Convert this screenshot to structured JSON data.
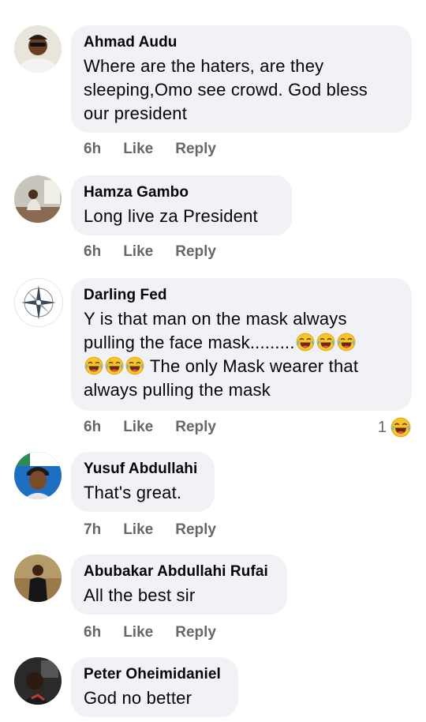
{
  "comments": [
    {
      "author": "Ahmad Audu",
      "lines": [
        "Where are the haters, are they",
        "sleeping,Omo see crowd. God bless",
        "our president"
      ],
      "time": "6h",
      "like": "Like",
      "reply": "Reply"
    },
    {
      "author": "Hamza Gambo",
      "lines": [
        "Long live za President"
      ],
      "time": "6h",
      "like": "Like",
      "reply": "Reply"
    },
    {
      "author": "Darling Fed",
      "line1": "Y is that man on the mask always",
      "line2": "pulling the face mask.........",
      "line3": "The only Mask wearer that",
      "line4": "always pulling the mask",
      "emoji": "tears-of-joy-emoji",
      "time": "6h",
      "like": "Like",
      "reply": "Reply",
      "reaction_count": "1",
      "reaction_icon": "haha-reaction-icon"
    },
    {
      "author": "Yusuf Abdullahi",
      "lines": [
        "That's great."
      ],
      "time": "7h",
      "like": "Like",
      "reply": "Reply"
    },
    {
      "author": "Abubakar Abdullahi Rufai",
      "lines": [
        "All the best sir"
      ],
      "time": "6h",
      "like": "Like",
      "reply": "Reply"
    },
    {
      "author": "Peter Oheimidaniel",
      "lines": [
        "God no better"
      ]
    }
  ],
  "colors": {
    "bubble": "#f0f2f5",
    "meta_text": "#65676b",
    "text": "#050505"
  }
}
